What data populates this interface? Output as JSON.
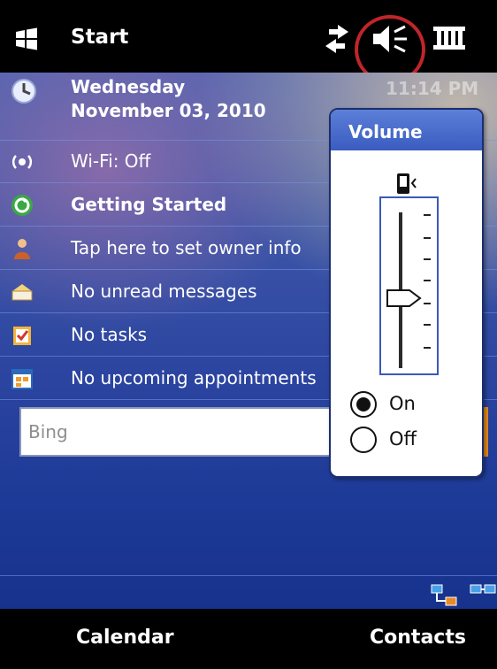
{
  "titlebar": {
    "title": "Start",
    "icons": [
      "windows-flag-icon",
      "sync-icon",
      "speaker-muted-icon",
      "battery-icon"
    ]
  },
  "today": {
    "day": "Wednesday",
    "date": "November 03, 2010",
    "time": "11:14 PM",
    "items": [
      {
        "icon": "wifi-icon",
        "label": "Wi-Fi: Off"
      },
      {
        "icon": "getting-started-icon",
        "label": "Getting Started"
      },
      {
        "icon": "owner-icon",
        "label": "Tap here to set owner info"
      },
      {
        "icon": "mail-icon",
        "label": "No unread messages"
      },
      {
        "icon": "tasks-icon",
        "label": "No tasks"
      },
      {
        "icon": "calendar-icon",
        "label": "No upcoming appointments"
      }
    ],
    "search": {
      "placeholder": "Bing"
    }
  },
  "volume_popup": {
    "title": "Volume",
    "level": 0.45,
    "options": [
      {
        "label": "On",
        "selected": true
      },
      {
        "label": "Off",
        "selected": false
      }
    ]
  },
  "softkeys": {
    "left": "Calendar",
    "right": "Contacts"
  },
  "colors": {
    "highlight_circle": "#c0252a",
    "accent": "#3a5cc0",
    "search_button": "#e68b1c"
  }
}
